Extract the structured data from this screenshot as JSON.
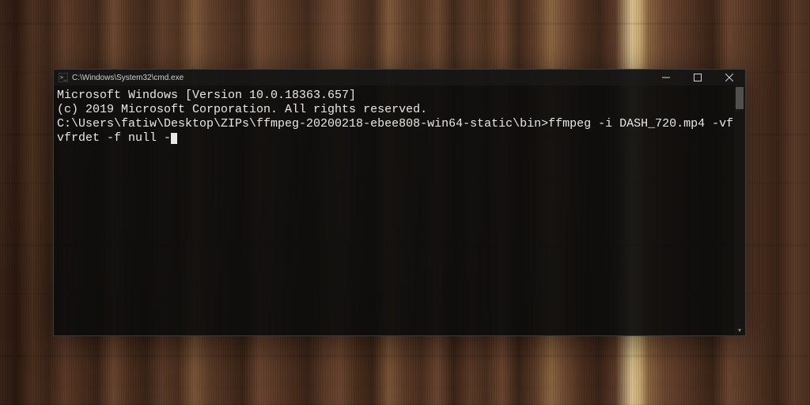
{
  "window": {
    "title": "C:\\Windows\\System32\\cmd.exe",
    "icon": "cmd-icon"
  },
  "terminal": {
    "line1": "Microsoft Windows [Version 10.0.18363.657]",
    "line2": "(c) 2019 Microsoft Corporation. All rights reserved.",
    "blank1": "",
    "prompt": "C:\\Users\\fatiw\\Desktop\\ZIPs\\ffmpeg-20200218-ebee808-win64-static\\bin>",
    "command": "ffmpeg -i DASH_720.mp4 -vf vfrdet -f null -"
  },
  "controls": {
    "minimize": "minimize",
    "maximize": "maximize",
    "close": "close"
  }
}
